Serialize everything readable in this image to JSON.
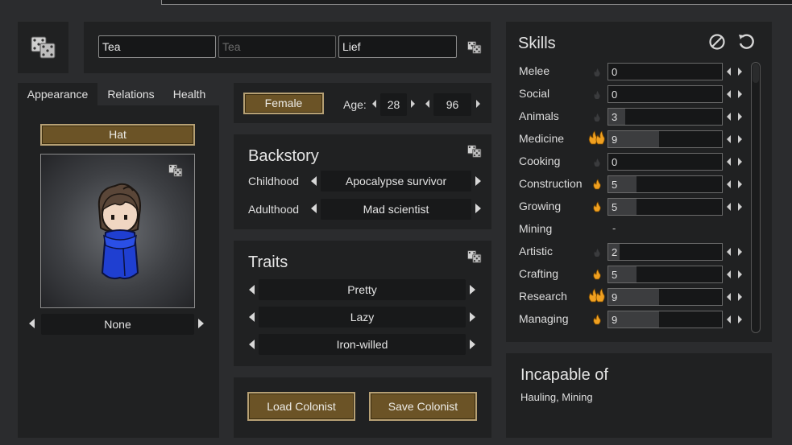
{
  "name": {
    "first": "Tea",
    "nick_placeholder": "Tea",
    "last": "Lief"
  },
  "tabs": [
    {
      "label": "Appearance",
      "active": true
    },
    {
      "label": "Relations",
      "active": false
    },
    {
      "label": "Health",
      "active": false
    }
  ],
  "appearance": {
    "hat_label": "Hat",
    "apparel_value": "None"
  },
  "gender": {
    "label": "Female"
  },
  "age": {
    "label": "Age:",
    "biological": "28",
    "chronological": "96"
  },
  "backstory": {
    "title": "Backstory",
    "childhood_label": "Childhood",
    "childhood_value": "Apocalypse survivor",
    "adulthood_label": "Adulthood",
    "adulthood_value": "Mad scientist"
  },
  "traits": {
    "title": "Traits",
    "items": [
      "Pretty",
      "Lazy",
      "Iron-willed"
    ]
  },
  "actions": {
    "load": "Load Colonist",
    "save": "Save Colonist"
  },
  "skills": {
    "title": "Skills",
    "items": [
      {
        "name": "Melee",
        "value": "0",
        "passion": "none",
        "level": 0
      },
      {
        "name": "Social",
        "value": "0",
        "passion": "none",
        "level": 0
      },
      {
        "name": "Animals",
        "value": "3",
        "passion": "none",
        "level": 3
      },
      {
        "name": "Medicine",
        "value": "9",
        "passion": "major",
        "level": 9
      },
      {
        "name": "Cooking",
        "value": "0",
        "passion": "none",
        "level": 0
      },
      {
        "name": "Construction",
        "value": "5",
        "passion": "minor",
        "level": 5
      },
      {
        "name": "Growing",
        "value": "5",
        "passion": "minor",
        "level": 5
      },
      {
        "name": "Mining",
        "value": "-",
        "passion": "disabled",
        "level": 0
      },
      {
        "name": "Artistic",
        "value": "2",
        "passion": "none",
        "level": 2
      },
      {
        "name": "Crafting",
        "value": "5",
        "passion": "minor",
        "level": 5
      },
      {
        "name": "Research",
        "value": "9",
        "passion": "major",
        "level": 9
      },
      {
        "name": "Managing",
        "value": "9",
        "passion": "minor",
        "level": 9
      }
    ]
  },
  "incapable": {
    "title": "Incapable of",
    "list": "Hauling, Mining"
  },
  "colors": {
    "panel": "#202122",
    "background": "#2b2c2e",
    "button_gold": "#6b5326",
    "passion_flame": "#f0a020"
  },
  "icons": {
    "dice": "dice-icon",
    "clear": "prohibit-icon",
    "reset": "undo-icon",
    "passion": "flame-icon"
  }
}
